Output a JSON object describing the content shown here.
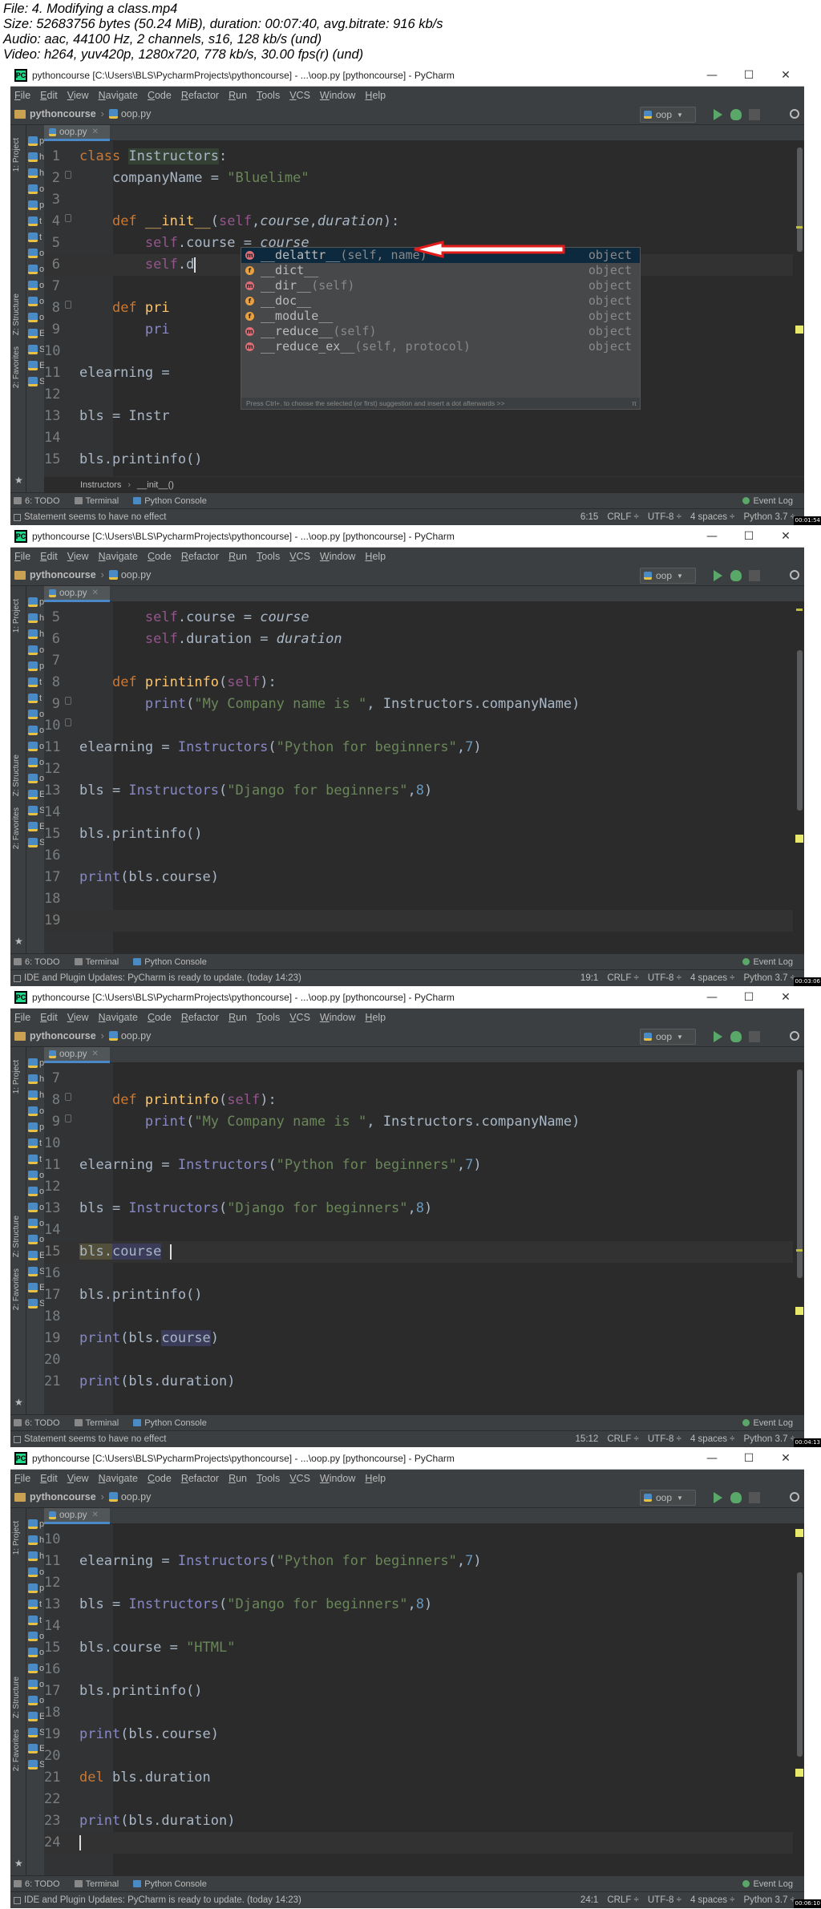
{
  "header": {
    "line1": "File: 4. Modifying a class.mp4",
    "line2": "Size: 52683756 bytes (50.24 MiB), duration: 00:07:40, avg.bitrate: 916 kb/s",
    "line3": "Audio: aac, 44100 Hz, 2 channels, s16, 128 kb/s (und)",
    "line4": "Video: h264, yuv420p, 1280x720, 778 kb/s, 30.00 fps(r) (und)"
  },
  "window": {
    "title": "pythoncourse [C:\\Users\\BLS\\PycharmProjects\\pythoncourse] - ...\\oop.py [pythoncourse] - PyCharm",
    "minimize": "—",
    "maximize": "☐",
    "close": "✕",
    "menu": [
      "File",
      "Edit",
      "View",
      "Navigate",
      "Code",
      "Refactor",
      "Run",
      "Tools",
      "VCS",
      "Window",
      "Help"
    ],
    "project_name": "pythoncourse",
    "file_name": "oop.py",
    "run_config": "oop",
    "tab_label": "oop.py",
    "project_label": "1: Project",
    "structure_label": "Z: Structure",
    "favorites_label": "2: Favorites",
    "tool_todo": "6: TODO",
    "tool_terminal": "Terminal",
    "tool_console": "Python Console",
    "event_log": "Event Log",
    "crlf": "CRLF ÷",
    "encoding": "UTF-8 ÷",
    "indent": "4 spaces ÷",
    "interpreter": "Python 3.7 ÷"
  },
  "frames": [
    {
      "status_message": "Statement seems to have no effect",
      "position": "6:15",
      "timestamp": "00:01:54",
      "breadcrumb": [
        "Instructors",
        "__init__()"
      ],
      "project_rows": [
        "pyth",
        "h",
        "h",
        "o",
        "p",
        "t",
        "t",
        "o",
        "o",
        "o",
        "o",
        "o",
        "E",
        "S",
        "Exte",
        "Scra"
      ],
      "lines": [
        {
          "n": "1",
          "html": "<span class=\"kw\">class </span><span class=\"cls hl\">Instructors</span>:"
        },
        {
          "n": "2",
          "html": "    companyName = <span class=\"st\">\"Bluelime\"</span>"
        },
        {
          "n": "3",
          "html": ""
        },
        {
          "n": "4",
          "html": "    <span class=\"kw\">def </span><span class=\"fn\">__init__</span>(<span class=\"sf\">self</span>,<span class=\"ipar\">course</span>,<span class=\"ipar\">duration</span>):"
        },
        {
          "n": "5",
          "html": "        <span class=\"sf\">self</span>.course = <span class=\"ipar\">course</span>"
        },
        {
          "n": "6",
          "html": "        <span class=\"sf\">self</span>.d<span class=\"caret\"></span>",
          "cur": true
        },
        {
          "n": "7",
          "html": ""
        },
        {
          "n": "8",
          "html": "    <span class=\"kw\">def </span><span class=\"fn\">pri</span>"
        },
        {
          "n": "9",
          "html": "        <span class=\"bi\">pri</span>                                                 anyName)"
        },
        {
          "n": "10",
          "html": ""
        },
        {
          "n": "11",
          "html": "elearning = "
        },
        {
          "n": "12",
          "html": ""
        },
        {
          "n": "13",
          "html": "bls = Instr"
        },
        {
          "n": "14",
          "html": ""
        },
        {
          "n": "15",
          "html": "bls.printinfo()"
        }
      ],
      "completion": {
        "items": [
          {
            "kind": "m",
            "name": "__delattr__",
            "sig": "(self, name)",
            "type": "object"
          },
          {
            "kind": "f",
            "name": "__dict__",
            "sig": "",
            "type": "object"
          },
          {
            "kind": "m",
            "name": "__dir__",
            "sig": "(self)",
            "type": "object"
          },
          {
            "kind": "f",
            "name": "__doc__",
            "sig": "",
            "type": "object"
          },
          {
            "kind": "f",
            "name": "__module__",
            "sig": "",
            "type": "object"
          },
          {
            "kind": "m",
            "name": "__reduce__",
            "sig": "(self)",
            "type": "object"
          },
          {
            "kind": "m",
            "name": "__reduce_ex__",
            "sig": "(self, protocol)",
            "type": "object"
          }
        ],
        "footer": "Press Ctrl+. to choose the selected (or first) suggestion and insert a dot afterwards >>",
        "pi": "π"
      }
    },
    {
      "status_message": "IDE and Plugin Updates: PyCharm is ready to update. (today 14:23)",
      "position": "19:1",
      "timestamp": "00:03:06",
      "breadcrumb": [],
      "project_rows": [
        "pyth",
        "h",
        "h",
        "o",
        "p",
        "t",
        "t",
        "o",
        "o",
        "o",
        "o",
        "o",
        "E",
        "S",
        "Exte",
        "Scra"
      ],
      "lines": [
        {
          "n": "",
          "html": ""
        },
        {
          "n": "5",
          "html": "        <span class=\"sf\">self</span>.course = <span class=\"ipar\">course</span>"
        },
        {
          "n": "6",
          "html": "        <span class=\"sf\">self</span>.duration = <span class=\"ipar\">duration</span>"
        },
        {
          "n": "7",
          "html": ""
        },
        {
          "n": "8",
          "html": "    <span class=\"kw\">def </span><span class=\"fn\">printinfo</span>(<span class=\"sf\">self</span>):"
        },
        {
          "n": "9",
          "html": "        <span class=\"bi\">print</span>(<span class=\"st\">\"My Company name is \"</span>, Instructors.companyName)"
        },
        {
          "n": "10",
          "html": ""
        },
        {
          "n": "11",
          "html": "elearning = <span class=\"bi\">Instructors</span>(<span class=\"st\">\"Python for beginners\"</span>,<span class=\"nu\">7</span>)"
        },
        {
          "n": "12",
          "html": ""
        },
        {
          "n": "13",
          "html": "bls = <span class=\"bi\">Instructors</span>(<span class=\"st\">\"Django for beginners\"</span>,<span class=\"nu\">8</span>)"
        },
        {
          "n": "14",
          "html": ""
        },
        {
          "n": "15",
          "html": "bls.printinfo()"
        },
        {
          "n": "16",
          "html": ""
        },
        {
          "n": "17",
          "html": "<span class=\"bi\">print</span>(bls.course)"
        },
        {
          "n": "18",
          "html": ""
        },
        {
          "n": "19",
          "html": "",
          "cur": true
        }
      ]
    },
    {
      "status_message": "Statement seems to have no effect",
      "position": "15:12",
      "timestamp": "00:04:13",
      "breadcrumb": [],
      "project_rows": [
        "pyth",
        "h",
        "h",
        "o",
        "p",
        "t",
        "t",
        "o",
        "o",
        "o",
        "o",
        "o",
        "E",
        "S",
        "Exte",
        "Scra"
      ],
      "lines": [
        {
          "n": "7",
          "html": ""
        },
        {
          "n": "8",
          "html": "    <span class=\"kw\">def </span><span class=\"fn\">printinfo</span>(<span class=\"sf\">self</span>):"
        },
        {
          "n": "9",
          "html": "        <span class=\"bi\">print</span>(<span class=\"st\">\"My Company name is \"</span>, Instructors.companyName)"
        },
        {
          "n": "10",
          "html": ""
        },
        {
          "n": "11",
          "html": "elearning = <span class=\"bi\">Instructors</span>(<span class=\"st\">\"Python for beginners\"</span>,<span class=\"nu\">7</span>)"
        },
        {
          "n": "12",
          "html": ""
        },
        {
          "n": "13",
          "html": "bls = <span class=\"bi\">Instructors</span>(<span class=\"st\">\"Django for beginners\"</span>,<span class=\"nu\">8</span>)"
        },
        {
          "n": "14",
          "html": ""
        },
        {
          "n": "15",
          "html": "<span class=\"warnbg\">bls.<span class=\"hl2\">course</span></span> <span class=\"caret\"></span>",
          "cur": true
        },
        {
          "n": "16",
          "html": ""
        },
        {
          "n": "17",
          "html": "bls.printinfo()"
        },
        {
          "n": "18",
          "html": ""
        },
        {
          "n": "19",
          "html": "<span class=\"bi\">print</span>(bls.<span class=\"hl2\">course</span>)"
        },
        {
          "n": "20",
          "html": ""
        },
        {
          "n": "21",
          "html": "<span class=\"bi\">print</span>(bls.duration)"
        }
      ]
    },
    {
      "status_message": "IDE and Plugin Updates: PyCharm is ready to update. (today 14:23)",
      "position": "24:1",
      "timestamp": "00:06:10",
      "breadcrumb": [],
      "project_rows": [
        "pyth",
        "h",
        "h",
        "o",
        "p",
        "t",
        "t",
        "o",
        "o",
        "o",
        "o",
        "o",
        "E",
        "S",
        "Exte",
        "Scra"
      ],
      "lines": [
        {
          "n": "10",
          "html": ""
        },
        {
          "n": "11",
          "html": "elearning = <span class=\"bi\">Instructors</span>(<span class=\"st\">\"Python for beginners\"</span>,<span class=\"nu\">7</span>)"
        },
        {
          "n": "12",
          "html": ""
        },
        {
          "n": "13",
          "html": "bls = <span class=\"bi\">Instructors</span>(<span class=\"st\">\"Django for beginners\"</span>,<span class=\"nu\">8</span>)"
        },
        {
          "n": "14",
          "html": ""
        },
        {
          "n": "15",
          "html": "bls.course = <span class=\"st\">\"HTML\"</span>"
        },
        {
          "n": "16",
          "html": ""
        },
        {
          "n": "17",
          "html": "bls.printinfo()"
        },
        {
          "n": "18",
          "html": ""
        },
        {
          "n": "19",
          "html": "<span class=\"bi\">print</span>(bls.course)"
        },
        {
          "n": "20",
          "html": ""
        },
        {
          "n": "21",
          "html": "<span class=\"kw\">del</span> bls.duration"
        },
        {
          "n": "22",
          "html": ""
        },
        {
          "n": "23",
          "html": "<span class=\"bi\">print</span>(bls.duration)"
        },
        {
          "n": "24",
          "html": "<span class=\"caret\"></span>",
          "cur": true
        }
      ]
    }
  ]
}
